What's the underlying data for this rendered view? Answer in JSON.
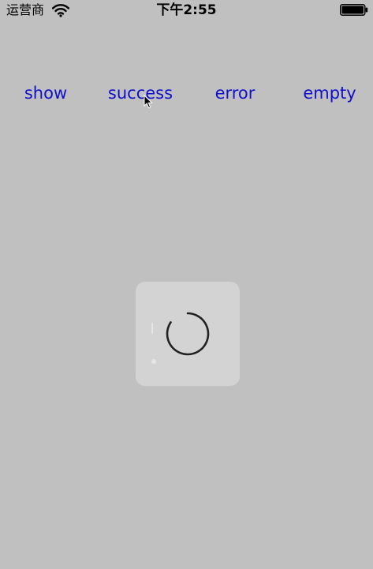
{
  "status_bar": {
    "carrier": "运营商",
    "time": "下午2:55"
  },
  "toolbar": {
    "show_label": "show",
    "success_label": "success",
    "error_label": "error",
    "empty_label": "empty"
  },
  "hud": {
    "state": "loading"
  },
  "colors": {
    "background": "#c0c0c0",
    "link": "#1010c8",
    "hud": "#d3d3d3",
    "spinner": "#222222"
  },
  "icons": [
    "wifi-icon",
    "battery-icon",
    "cursor-icon",
    "loading-spinner-icon"
  ]
}
